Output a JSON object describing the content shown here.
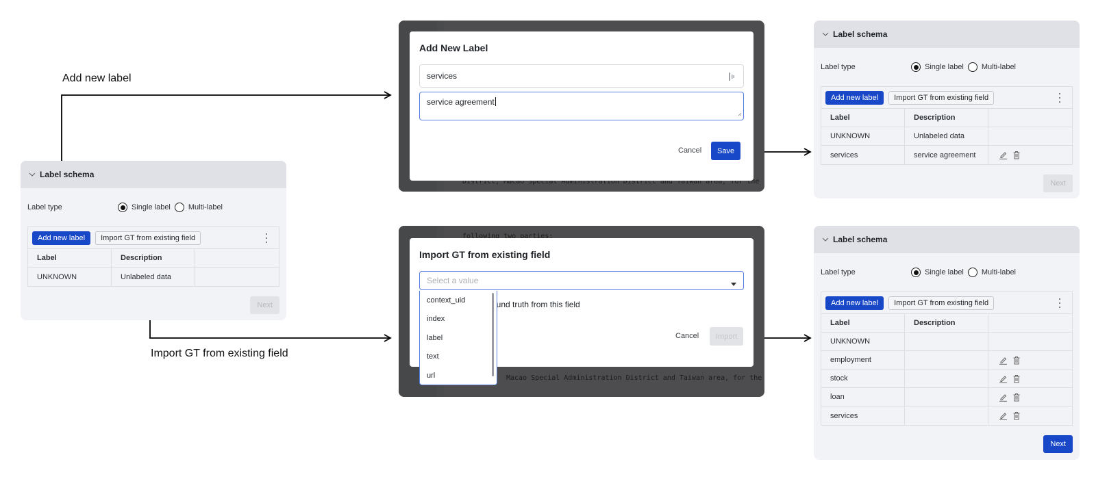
{
  "annotations": {
    "add_new_label": "Add new label",
    "import_gt": "Import GT from existing field"
  },
  "initial_panel": {
    "title": "Label schema",
    "label_type_label": "Label type",
    "options": {
      "single": "Single label",
      "multi": "Multi-label"
    },
    "selected_option": "single",
    "add_button": "Add new label",
    "import_button": "Import GT from existing field",
    "columns": [
      "Label",
      "Description",
      ""
    ],
    "rows": [
      {
        "label": "UNKNOWN",
        "description": "Unlabeled data",
        "editable": false
      }
    ],
    "next_button": "Next",
    "next_enabled": false
  },
  "add_modal": {
    "title": "Add New Label",
    "name_value": "services",
    "description_value": "service agreement",
    "cancel": "Cancel",
    "save": "Save",
    "bg_text_bottom": "District, Macao Special Administration District and Taiwan area, for the"
  },
  "import_modal": {
    "title": "Import GT from existing field",
    "select_placeholder": "Select a value",
    "options": [
      "context_uid",
      "index",
      "label",
      "text",
      "url"
    ],
    "checkbox_text_partial": "ound truth from this field",
    "cancel": "Cancel",
    "import": "Import",
    "bg_text_top": "following two parties:",
    "bg_text_bottom": "Macao Special Administration District and Taiwan area, for the"
  },
  "result_panel_add": {
    "title": "Label schema",
    "label_type_label": "Label type",
    "options": {
      "single": "Single label",
      "multi": "Multi-label"
    },
    "selected_option": "single",
    "add_button": "Add new label",
    "import_button": "Import GT from existing field",
    "columns": [
      "Label",
      "Description",
      ""
    ],
    "rows": [
      {
        "label": "UNKNOWN",
        "description": "Unlabeled data",
        "editable": false
      },
      {
        "label": "services",
        "description": "service agreement",
        "editable": true
      }
    ],
    "next_button": "Next",
    "next_enabled": false
  },
  "result_panel_import": {
    "title": "Label schema",
    "label_type_label": "Label type",
    "options": {
      "single": "Single label",
      "multi": "Multi-label"
    },
    "selected_option": "single",
    "add_button": "Add new label",
    "import_button": "Import GT from existing field",
    "columns": [
      "Label",
      "Description",
      ""
    ],
    "rows": [
      {
        "label": "UNKNOWN",
        "description": "",
        "editable": false
      },
      {
        "label": "employment",
        "description": "",
        "editable": true
      },
      {
        "label": "stock",
        "description": "",
        "editable": true
      },
      {
        "label": "loan",
        "description": "",
        "editable": true
      },
      {
        "label": "services",
        "description": "",
        "editable": true
      }
    ],
    "next_button": "Next",
    "next_enabled": true
  },
  "colors": {
    "primary": "#1848c8",
    "focus_border": "#5a7ee0",
    "panel_bg": "#f2f3f6",
    "panel_header": "#dfe1e6",
    "overlay": "#4d4d4f"
  }
}
